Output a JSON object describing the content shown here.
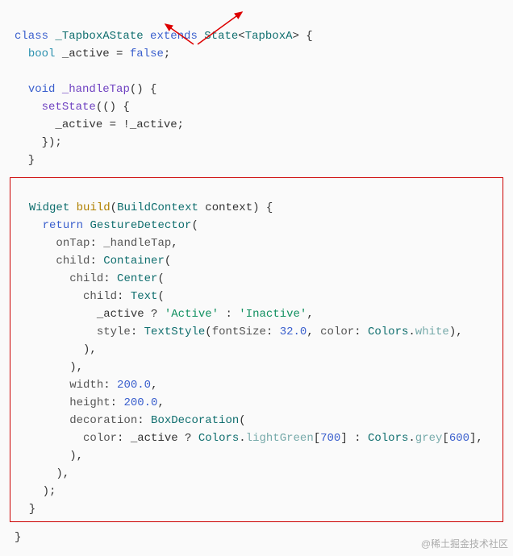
{
  "code_top": {
    "l1": {
      "kw1": "class",
      "name": "_TapboxAState",
      "kw2": "extends",
      "state": "State",
      "tparam": "TapboxA",
      "brace": "> {"
    },
    "l2": {
      "type": "bool",
      "var": "_active",
      "eq": " = ",
      "val": "false",
      "semi": ";"
    },
    "l3": {
      "kw": "void",
      "fn": "_handleTap",
      "rest": "() {"
    },
    "l4": {
      "fn": "setState",
      "rest": "(() {"
    },
    "l5": {
      "lhs": "_active",
      "eq": " = !",
      "rhs": "_active",
      "semi": ";"
    },
    "l6": "    });",
    "l7": "  }"
  },
  "code_box": {
    "l1": {
      "type": "Widget",
      "fn": "build",
      "paren": "(",
      "ptype": "BuildContext",
      "pname": " context",
      "rest": ") {"
    },
    "l2": {
      "kw": "return",
      "cls": "GestureDetector",
      "rest": "("
    },
    "l3": {
      "key": "onTap",
      "colon": ": ",
      "val": "_handleTap",
      "comma": ","
    },
    "l4": {
      "key": "child",
      "colon": ": ",
      "cls": "Container",
      "rest": "("
    },
    "l5": {
      "key": "child",
      "colon": ": ",
      "cls": "Center",
      "rest": "("
    },
    "l6": {
      "key": "child",
      "colon": ": ",
      "cls": "Text",
      "rest": "("
    },
    "l7": {
      "cond": "_active",
      "q": " ? ",
      "a": "'Active'",
      "c": " : ",
      "b": "'Inactive'",
      "comma": ","
    },
    "l8": {
      "key": "style",
      "colon": ": ",
      "cls": "TextStyle",
      "open": "(",
      "k1": "fontSize",
      "v1": "32.0",
      "sep": ", ",
      "k2": "color",
      "colon2": ": ",
      "colors": "Colors",
      "dot": ".",
      "white": "white",
      "close": "),"
    },
    "l9": "          ),",
    "l10": "        ),",
    "l11": {
      "key": "width",
      "colon": ": ",
      "val": "200.0",
      "comma": ","
    },
    "l12": {
      "key": "height",
      "colon": ": ",
      "val": "200.0",
      "comma": ","
    },
    "l13": {
      "key": "decoration",
      "colon": ": ",
      "cls": "BoxDecoration",
      "rest": "("
    },
    "l14": {
      "key": "color",
      "colon": ": ",
      "cond": "_active",
      "q": " ? ",
      "colors1": "Colors",
      "d1": ".",
      "lg": "lightGreen",
      "idx1": "[",
      "n1": "700",
      "idx1c": "]",
      "c": " : ",
      "colors2": "Colors",
      "d2": ".",
      "grey": "grey",
      "idx2": "[",
      "n2": "600",
      "idx2c": "],",
      "end": ""
    },
    "l15": "        ),",
    "l16": "      ),",
    "l17": "    );",
    "l18": "  }"
  },
  "closing_brace": "}",
  "watermark": "@稀土掘金技术社区"
}
